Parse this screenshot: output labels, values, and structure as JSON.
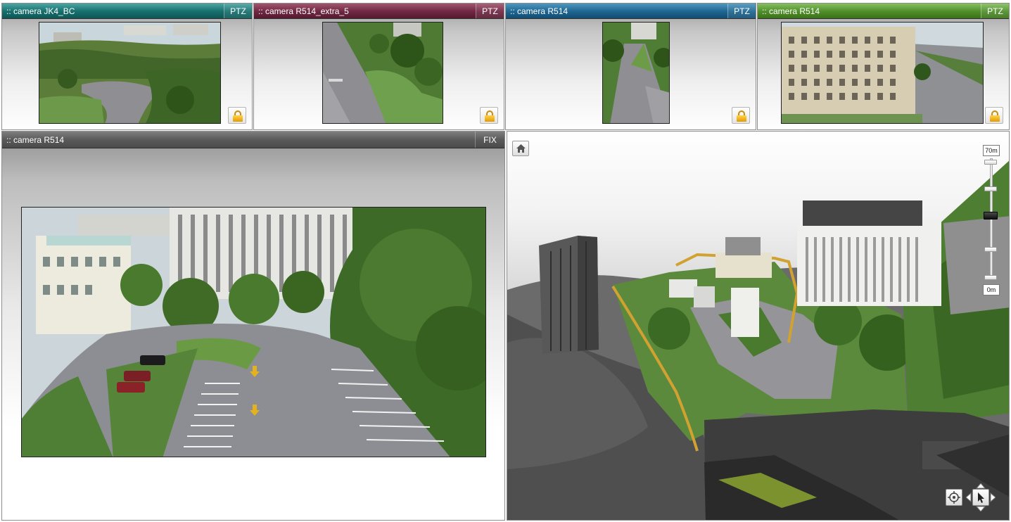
{
  "top_cameras": [
    {
      "title": ":: camera JK4_BC",
      "mode": "PTZ",
      "color": "#166e6c"
    },
    {
      "title": ":: camera R514_extra_5",
      "mode": "PTZ",
      "color": "#6e2741"
    },
    {
      "title": ":: camera R514",
      "mode": "PTZ",
      "color": "#1e6590"
    },
    {
      "title": ":: camera R514",
      "mode": "PTZ",
      "color": "#4f8d2a"
    }
  ],
  "fixed_camera": {
    "title": ":: camera R514",
    "mode": "FIX"
  },
  "map": {
    "zoom_max_label": "70m",
    "zoom_min_label": "0m",
    "controls": [
      "home-icon",
      "target-icon",
      "pan-arrows-icon",
      "pointer-icon",
      "lock-icon"
    ]
  }
}
